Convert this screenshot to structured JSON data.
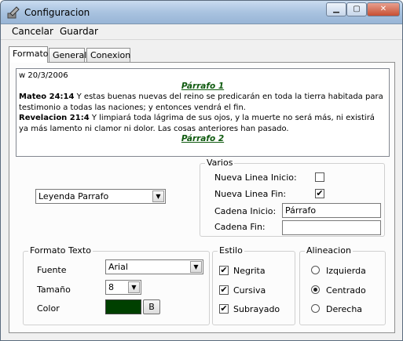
{
  "window": {
    "title": "Configuracion",
    "min_glyph": "▁",
    "max_glyph": "▢",
    "close_glyph": "✕"
  },
  "menu": {
    "cancel": "Cancelar",
    "save": "Guardar"
  },
  "tabs": [
    {
      "label": "Formato"
    },
    {
      "label": "General"
    },
    {
      "label": "Conexion"
    }
  ],
  "preview": {
    "date": "w 20/3/2006",
    "heading1": "Párrafo 1",
    "v1_ref": "Mateo 24:14",
    "v1_text": " Y estas buenas nuevas del reino se predicarán en toda la tierra habitada para testimonio a todas las naciones; y entonces vendrá el fin.",
    "v2_ref": "Revelacion 21:4",
    "v2_text": " Y limpiará toda lágrima de sus ojos, y la muerte no será más, ni existirá ya más lamento ni clamor ni dolor. Las cosas anteriores han pasado.",
    "heading2": "Párrafo 2"
  },
  "element_select": {
    "value": "Leyenda Parrafo"
  },
  "varios": {
    "title": "Varios",
    "nueva_linea_inicio": {
      "label": "Nueva Linea Inicio:",
      "checked": false
    },
    "nueva_linea_fin": {
      "label": "Nueva Linea Fin:",
      "checked": true,
      "mark": "✔"
    },
    "cadena_inicio": {
      "label": "Cadena Inicio:",
      "value": "Párrafo"
    },
    "cadena_fin": {
      "label": "Cadena Fin:",
      "value": ""
    }
  },
  "formato_texto": {
    "title": "Formato Texto",
    "fuente_label": "Fuente",
    "fuente_value": "Arial",
    "tamano_label": "Tamaño",
    "tamano_value": "8",
    "color_label": "Color",
    "color_value": "#004000",
    "color_button": "B"
  },
  "estilo": {
    "title": "Estilo",
    "negrita": {
      "label": "Negrita",
      "checked": true,
      "mark": "✔"
    },
    "cursiva": {
      "label": "Cursiva",
      "checked": true,
      "mark": "✔"
    },
    "subrayado": {
      "label": "Subrayado",
      "checked": true,
      "mark": "✔"
    }
  },
  "alineacion": {
    "title": "Alineacion",
    "options": [
      {
        "label": "Izquierda",
        "selected": false
      },
      {
        "label": "Centrado",
        "selected": true
      },
      {
        "label": "Derecha",
        "selected": false
      }
    ]
  },
  "icons": {
    "dropdown": "▼"
  }
}
